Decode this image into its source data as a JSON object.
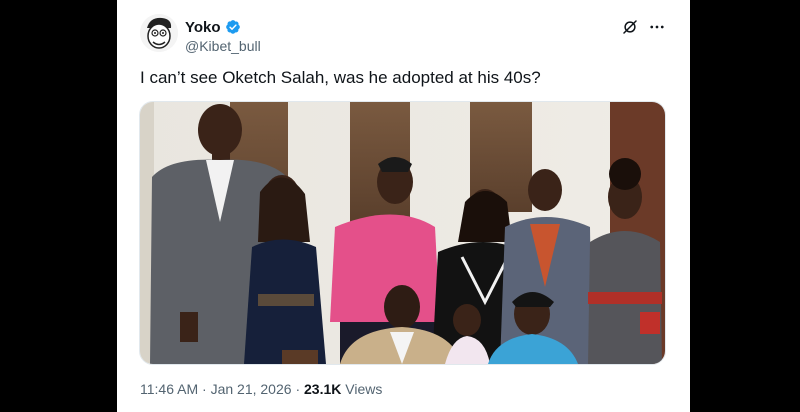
{
  "post": {
    "author": {
      "display_name": "Yoko",
      "handle": "@Kibet_bull",
      "verified": true
    },
    "text": "I can’t see Oketch Salah, was he adopted at his 40s?",
    "meta": {
      "time": "11:46 AM",
      "date": "Jan 21, 2026",
      "views_count": "23.1K",
      "views_label": "Views",
      "separator": "·"
    },
    "icons": {
      "grok": "grok-icon",
      "more": "more-icon",
      "verified": "verified-badge-icon"
    },
    "media": {
      "description": "family-photo"
    }
  },
  "colors": {
    "background": "#000000",
    "card": "#ffffff",
    "primary_text": "#0f1419",
    "secondary_text": "#536471",
    "verified": "#1d9bf0"
  }
}
